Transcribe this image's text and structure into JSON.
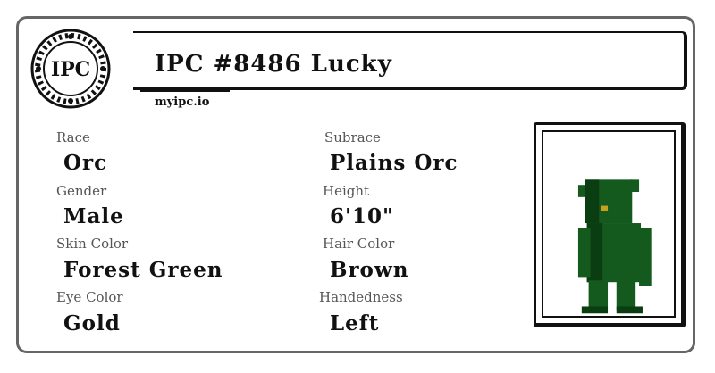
{
  "logo": {
    "text": "IPC",
    "icon": "ipc-seal-icon"
  },
  "header": {
    "title": "IPC #8486 Lucky",
    "site": "myipc.io"
  },
  "fields": {
    "race": {
      "label": "Race",
      "value": "Orc"
    },
    "subrace": {
      "label": "Subrace",
      "value": "Plains Orc"
    },
    "gender": {
      "label": "Gender",
      "value": "Male"
    },
    "height": {
      "label": "Height",
      "value": "6'10\""
    },
    "skin_color": {
      "label": "Skin Color",
      "value": "Forest Green"
    },
    "hair_color": {
      "label": "Hair Color",
      "value": "Brown"
    },
    "eye_color": {
      "label": "Eye Color",
      "value": "Gold"
    },
    "handedness": {
      "label": "Handedness",
      "value": "Left"
    }
  },
  "colors": {
    "skin_dark": "#0b3d12",
    "skin_mid": "#145a1f",
    "skin_light": "#1f7a2c",
    "eye": "#c8a020",
    "card_border": "#666666"
  }
}
